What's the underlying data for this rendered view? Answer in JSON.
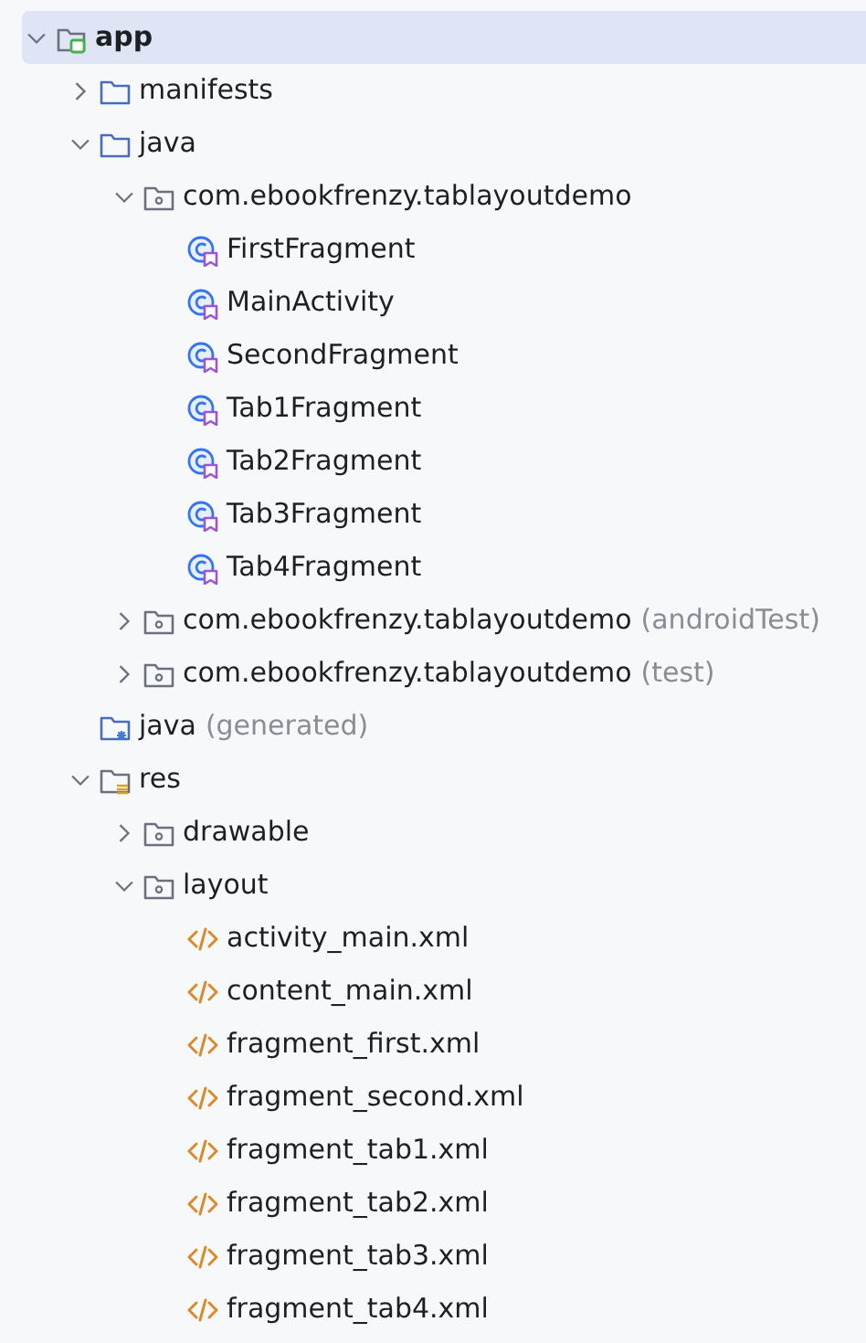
{
  "tree": [
    {
      "label": "app",
      "kind": "module",
      "expanded": true,
      "selected": true,
      "children": [
        {
          "label": "manifests",
          "kind": "folder",
          "expanded": false,
          "selected": false
        },
        {
          "label": "java",
          "kind": "folder",
          "expanded": true,
          "selected": false,
          "children": [
            {
              "label": "com.ebookfrenzy.tablayoutdemo",
              "kind": "package",
              "expanded": true,
              "selected": false,
              "children": [
                {
                  "label": "FirstFragment",
                  "kind": "class",
                  "selected": false
                },
                {
                  "label": "MainActivity",
                  "kind": "class",
                  "selected": false
                },
                {
                  "label": "SecondFragment",
                  "kind": "class",
                  "selected": false
                },
                {
                  "label": "Tab1Fragment",
                  "kind": "class",
                  "selected": false
                },
                {
                  "label": "Tab2Fragment",
                  "kind": "class",
                  "selected": false
                },
                {
                  "label": "Tab3Fragment",
                  "kind": "class",
                  "selected": false
                },
                {
                  "label": "Tab4Fragment",
                  "kind": "class",
                  "selected": false
                }
              ]
            },
            {
              "label": "com.ebookfrenzy.tablayoutdemo",
              "suffix": "(androidTest)",
              "kind": "package",
              "expanded": false,
              "selected": false
            },
            {
              "label": "com.ebookfrenzy.tablayoutdemo",
              "suffix": "(test)",
              "kind": "package",
              "expanded": false,
              "selected": false
            }
          ]
        },
        {
          "label": "java",
          "suffix": "(generated)",
          "kind": "generated",
          "selected": false
        },
        {
          "label": "res",
          "kind": "res",
          "expanded": true,
          "selected": false,
          "children": [
            {
              "label": "drawable",
              "kind": "package",
              "expanded": false,
              "selected": false
            },
            {
              "label": "layout",
              "kind": "package",
              "expanded": true,
              "selected": false,
              "children": [
                {
                  "label": "activity_main.xml",
                  "kind": "xml",
                  "selected": false
                },
                {
                  "label": "content_main.xml",
                  "kind": "xml",
                  "selected": false
                },
                {
                  "label": "fragment_first.xml",
                  "kind": "xml",
                  "selected": false
                },
                {
                  "label": "fragment_second.xml",
                  "kind": "xml",
                  "selected": false
                },
                {
                  "label": "fragment_tab1.xml",
                  "kind": "xml",
                  "selected": false
                },
                {
                  "label": "fragment_tab2.xml",
                  "kind": "xml",
                  "selected": false
                },
                {
                  "label": "fragment_tab3.xml",
                  "kind": "xml",
                  "selected": false
                },
                {
                  "label": "fragment_tab4.xml",
                  "kind": "xml",
                  "selected": false
                }
              ]
            }
          ]
        }
      ]
    }
  ]
}
